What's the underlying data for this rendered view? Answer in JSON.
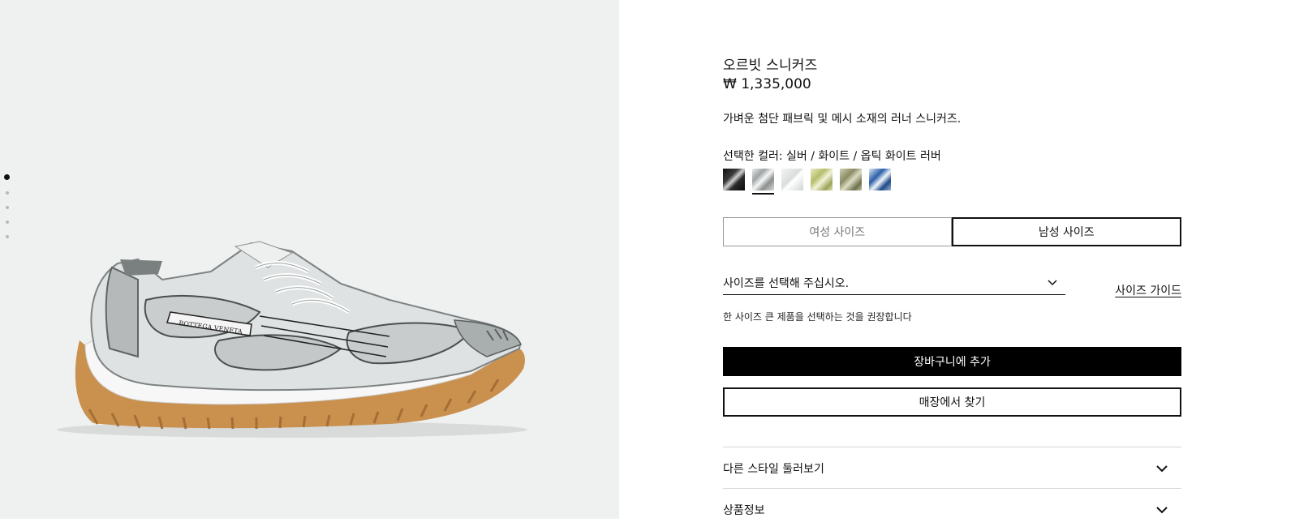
{
  "product": {
    "title": "오르빗 스니커즈",
    "price": "₩ 1,335,000",
    "description": "가벼운 첨단 패브릭 및 메시 소재의 러너 스니커즈.",
    "color_label": "선택한 컬러: 실버 / 화이트 / 옵틱 화이트 러버"
  },
  "gallery": {
    "image_count": 5,
    "active_index": 0
  },
  "swatches": {
    "selected_index": 1,
    "names": [
      "black-swatch",
      "silver-swatch",
      "white-swatch",
      "lime-swatch",
      "olive-swatch",
      "blue-swatch"
    ]
  },
  "size_tabs": {
    "women": "여성 사이즈",
    "men": "남성 사이즈",
    "active": "men"
  },
  "size_select": {
    "placeholder": "사이즈를 선택해 주십시오."
  },
  "size_guide": "사이즈 가이드",
  "size_note": "한 사이즈 큰 제품을 선택하는 것을 권장합니다",
  "buttons": {
    "add_to_cart": "장바구니에 추가",
    "find_in_store": "매장에서 찾기"
  },
  "accordion": [
    {
      "label": "다른 스타일 둘러보기"
    },
    {
      "label": "상품정보"
    }
  ],
  "colors": {
    "gallery_bg": "#eff1f0",
    "primary": "#000000",
    "sole": "#c9904e"
  },
  "icons": {
    "dropdown": "chevron-down-icon",
    "accordion": "chevron-down-icon"
  }
}
